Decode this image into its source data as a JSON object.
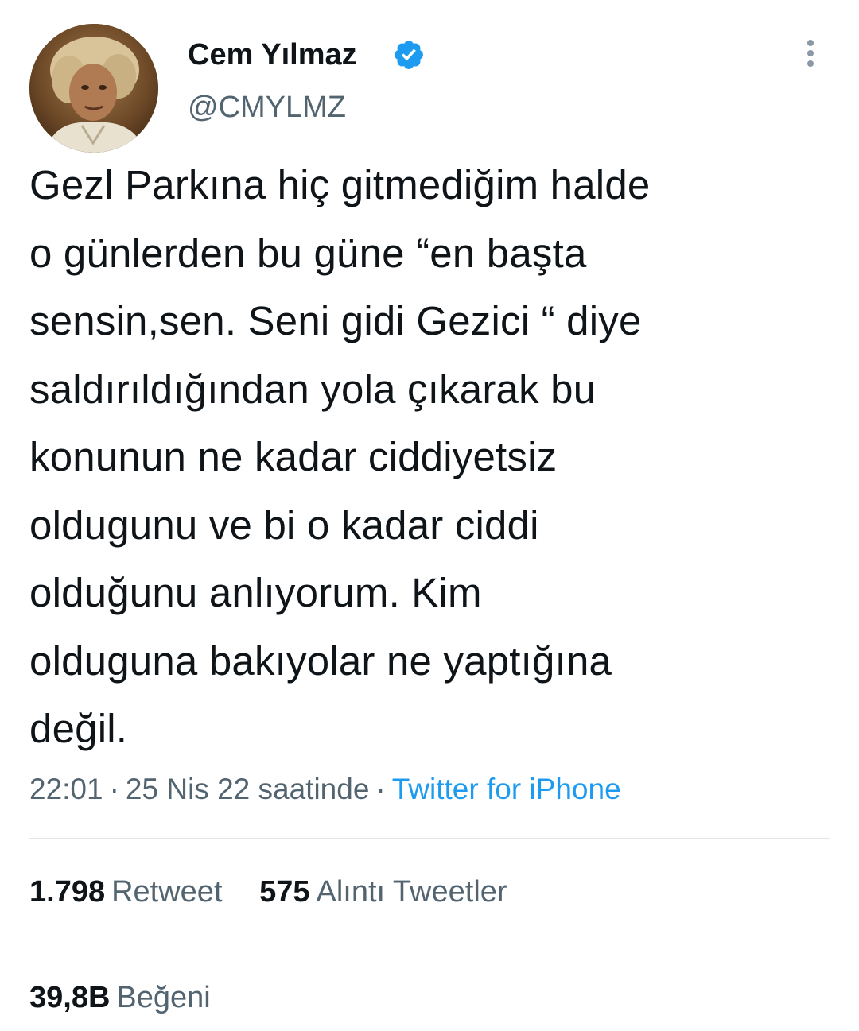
{
  "author": {
    "display_name": "Cem Yılmaz",
    "handle": "@CMYLMZ",
    "verified": true,
    "verified_color": "#1d9bf0"
  },
  "tweet": {
    "text": "Gezl Parkına hiç gitmediğim halde\no günlerden bu güne  “en başta\nsensin,sen. Seni gidi Gezici “ diye\nsaldırıldığından yola çıkarak  bu\nkonunun ne kadar ciddiyetsiz\noldugunu ve bi o kadar ciddi\nolduğunu anlıyorum. Kim\nolduguna bakıyolar ne yaptığına\ndeğil.",
    "time": "22:01",
    "separator": "·",
    "date": "25 Nis 22 saatinde",
    "source": "Twitter for iPhone"
  },
  "stats": {
    "retweets": {
      "count": "1.798",
      "label": "Retweet"
    },
    "quotes": {
      "count": "575",
      "label": "Alıntı Tweetler"
    },
    "likes": {
      "count": "39,8B",
      "label": "Beğeni"
    }
  },
  "icons": {
    "more": "more-vertical-icon",
    "verified": "verified-badge-icon"
  },
  "colors": {
    "text_primary": "#0f1419",
    "text_secondary": "#536471",
    "accent": "#1d9bf0",
    "divider": "#e1e6ea"
  }
}
